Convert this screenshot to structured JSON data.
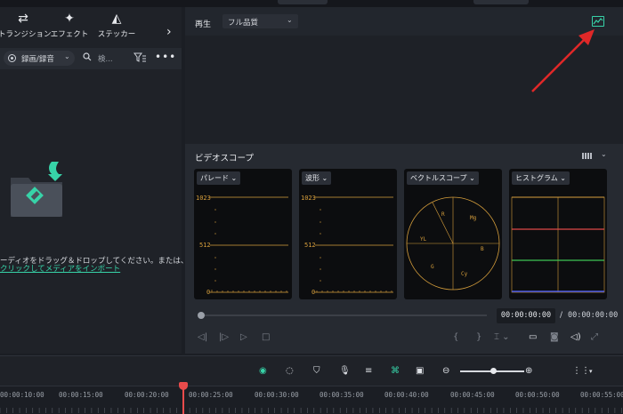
{
  "toolbar": {
    "items": [
      {
        "label": "トランジション",
        "icon": "transition-icon"
      },
      {
        "label": "エフェクト",
        "icon": "effects-icon"
      },
      {
        "label": "ステッカー",
        "icon": "sticker-icon"
      }
    ]
  },
  "media": {
    "filter_label": "録画/録音",
    "search_placeholder": "検...",
    "drop_text": "ーディオをドラッグ＆ドロップしてください。または、",
    "import_link": "クリックしてメディアをインポート"
  },
  "preview": {
    "play_label": "再生",
    "quality": "フル品質"
  },
  "scope": {
    "title": "ビデオスコープ",
    "panels": [
      {
        "label": "パレード",
        "ticks": [
          "1023",
          "512",
          "0"
        ]
      },
      {
        "label": "波形",
        "ticks": [
          "1023",
          "512",
          "0"
        ]
      },
      {
        "label": "ベクトルスコープ",
        "targets": [
          "R",
          "Mg",
          "YL",
          "B",
          "G",
          "Cy"
        ]
      },
      {
        "label": "ヒストグラム"
      }
    ],
    "current_time": "00:00:00:00",
    "total_time": "00:00:00:00"
  },
  "timeline": {
    "times": [
      "00:00:10:00",
      "00:00:15:00",
      "00:00:20:00",
      "00:00:25:00",
      "00:00:30:00",
      "00:00:35:00",
      "00:00:40:00",
      "00:00:45:00",
      "00:00:50:00",
      "00:00:55:00"
    ]
  },
  "colors": {
    "accent": "#37d3a8",
    "playhead": "#e94b4b",
    "scope_amber": "#d79f3c",
    "hist_red": "#e04848",
    "hist_green": "#3ec654",
    "hist_blue": "#4a5ae8"
  }
}
